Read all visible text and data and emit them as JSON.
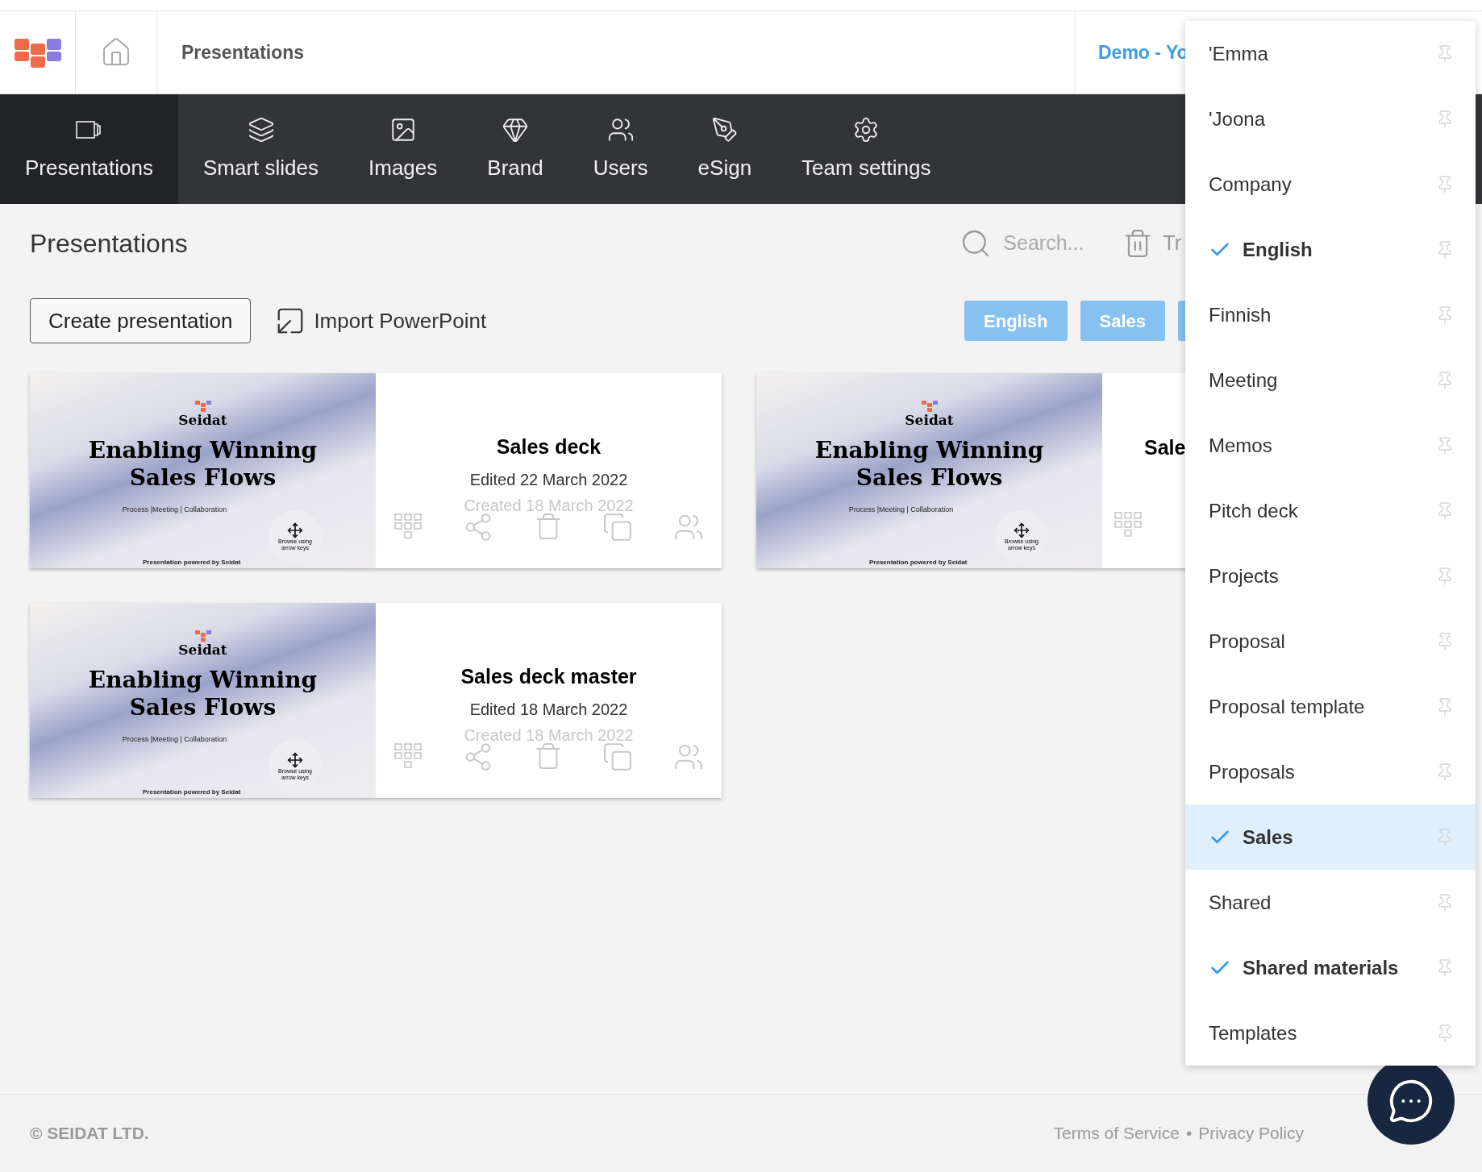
{
  "header": {
    "title": "Presentations",
    "account": "Demo - Yo"
  },
  "nav": [
    {
      "label": "Presentations",
      "selected": true
    },
    {
      "label": "Smart slides",
      "selected": false
    },
    {
      "label": "Images",
      "selected": false
    },
    {
      "label": "Brand",
      "selected": false
    },
    {
      "label": "Users",
      "selected": false
    },
    {
      "label": "eSign",
      "selected": false
    },
    {
      "label": "Team settings",
      "selected": false
    }
  ],
  "page": {
    "title": "Presentations",
    "search": {
      "placeholder": "Search..."
    },
    "trash": "Tr",
    "create_button": "Create presentation",
    "import_button": "Import PowerPoint",
    "filters": [
      {
        "label": "English"
      },
      {
        "label": "Sales"
      }
    ]
  },
  "cards": [
    {
      "title": "Sales deck",
      "edited": "Edited 22 March 2022",
      "created": "Created 18 March 2022",
      "partial": false,
      "slide": {
        "brand": "Seidat",
        "headline": "Enabling Winning Sales Flows",
        "tagline": "Process |Meeting | Collaboration",
        "hint": "Browse using arrow keys",
        "footer": "Presentation powered by Seidat"
      }
    },
    {
      "title": "Sale",
      "partial": true,
      "slide": {
        "brand": "Seidat",
        "headline": "Enabling Winning Sales Flows",
        "tagline": "Process |Meeting | Collaboration",
        "hint": "Browse using arrow keys",
        "footer": "Presentation powered by Seidat"
      }
    },
    {
      "title": "Sales deck master",
      "edited": "Edited 18 March 2022",
      "created": "Created 18 March 2022",
      "partial": false,
      "slide": {
        "brand": "Seidat",
        "headline": "Enabling Winning Sales Flows",
        "tagline": "Process |Meeting | Collaboration",
        "hint": "Browse using arrow keys",
        "footer": "Presentation powered by Seidat"
      }
    }
  ],
  "tag_menu": [
    {
      "label": "'Emma",
      "checked": false,
      "selected": false
    },
    {
      "label": "'Joona",
      "checked": false,
      "selected": false
    },
    {
      "label": "Company",
      "checked": false,
      "selected": false
    },
    {
      "label": "English",
      "checked": true,
      "selected": false
    },
    {
      "label": "Finnish",
      "checked": false,
      "selected": false
    },
    {
      "label": "Meeting",
      "checked": false,
      "selected": false
    },
    {
      "label": "Memos",
      "checked": false,
      "selected": false
    },
    {
      "label": "Pitch deck",
      "checked": false,
      "selected": false
    },
    {
      "label": "Projects",
      "checked": false,
      "selected": false
    },
    {
      "label": "Proposal",
      "checked": false,
      "selected": false
    },
    {
      "label": "Proposal template",
      "checked": false,
      "selected": false
    },
    {
      "label": "Proposals",
      "checked": false,
      "selected": false
    },
    {
      "label": "Sales",
      "checked": true,
      "selected": true
    },
    {
      "label": "Shared",
      "checked": false,
      "selected": false
    },
    {
      "label": "Shared materials",
      "checked": true,
      "selected": false
    },
    {
      "label": "Templates",
      "checked": false,
      "selected": false
    }
  ],
  "footer": {
    "copyright": "© SEIDAT LTD.",
    "links": [
      "Terms of Service",
      "Privacy Policy"
    ],
    "separator": "•"
  }
}
